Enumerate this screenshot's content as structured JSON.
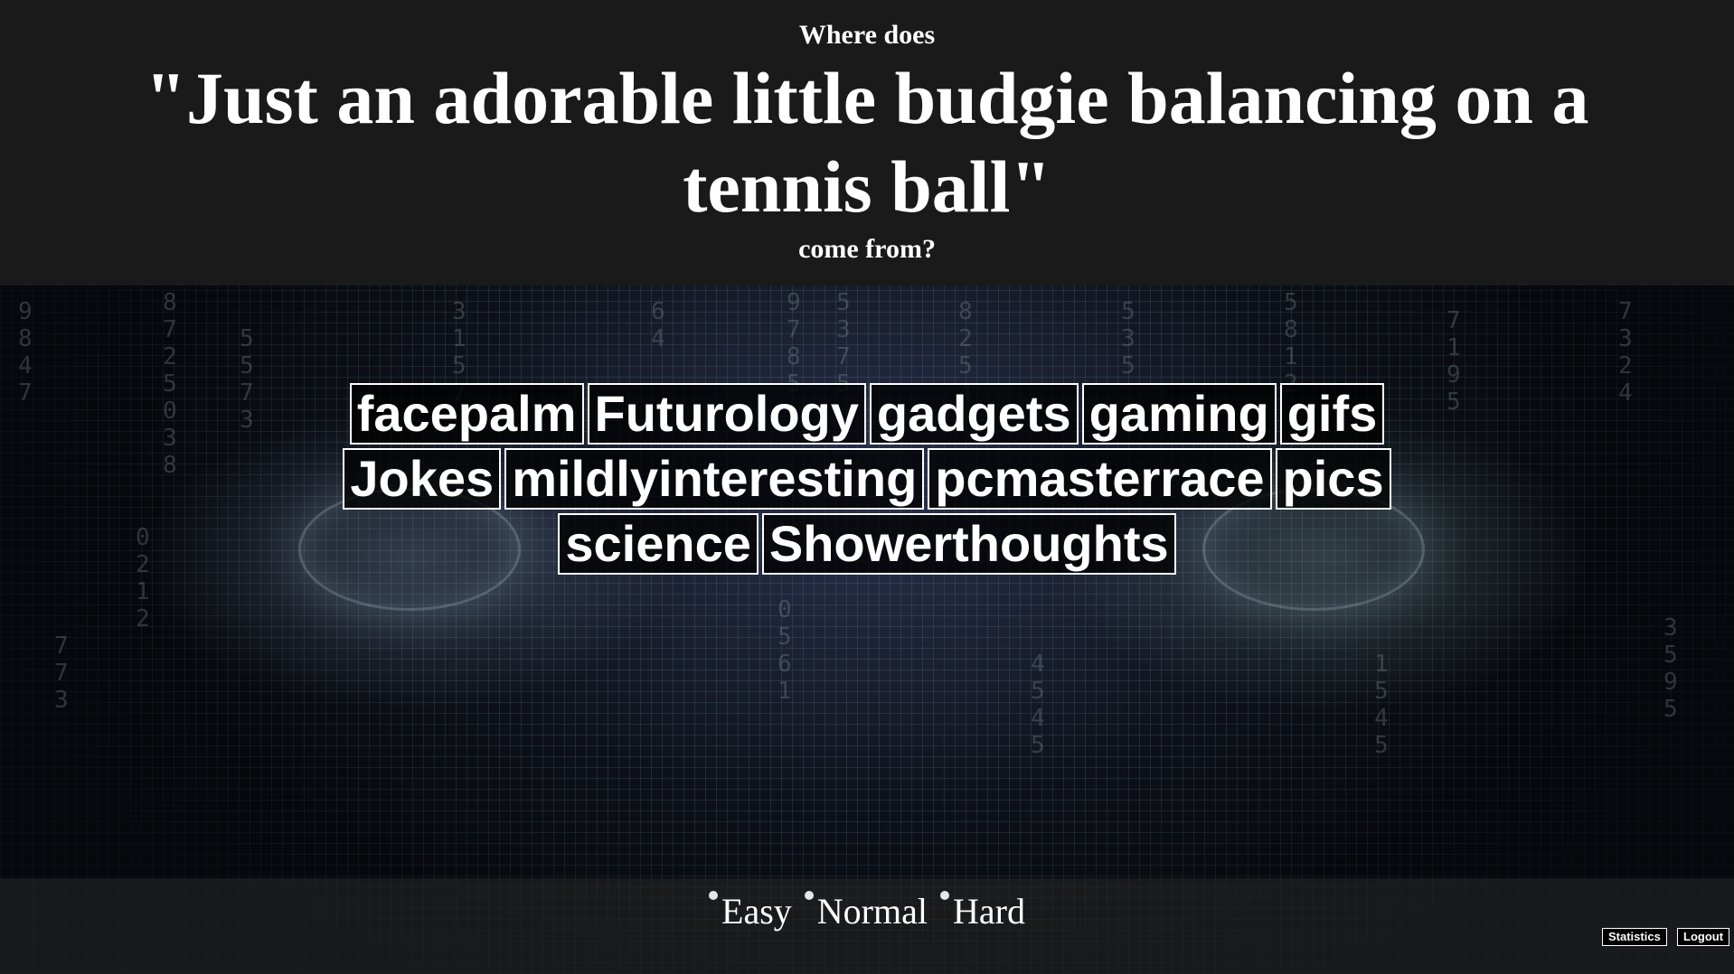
{
  "header": {
    "prefix": "Where does",
    "quote": "\"Just an adorable little budgie balancing on a tennis ball\"",
    "suffix": "come from?"
  },
  "subreddits": [
    "facepalm",
    "Futurology",
    "gadgets",
    "gaming",
    "gifs",
    "Jokes",
    "mildlyinteresting",
    "pcmasterrace",
    "pics",
    "science",
    "Showerthoughts"
  ],
  "difficulty": {
    "options": [
      "Easy",
      "Normal",
      "Hard"
    ]
  },
  "footer": {
    "statistics_label": "Statistics",
    "logout_label": "Logout"
  }
}
